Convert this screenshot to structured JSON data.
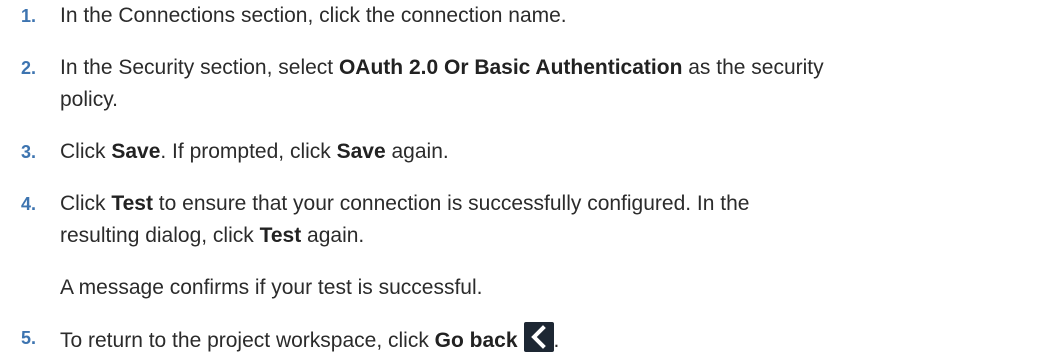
{
  "steps": [
    {
      "number": "1.",
      "parts": [
        "In the Connections section, click the connection name."
      ]
    },
    {
      "number": "2.",
      "parts": [
        "In the Security section, select ",
        "OAuth 2.0 Or Basic Authentication",
        " as the security",
        "policy."
      ]
    },
    {
      "number": "3.",
      "parts": [
        "Click ",
        "Save",
        ". If prompted, click ",
        "Save",
        " again."
      ]
    },
    {
      "number": "4.",
      "parts": [
        "Click ",
        "Test",
        " to ensure that your connection is successfully configured. In the",
        "resulting dialog, click ",
        "Test",
        " again."
      ],
      "note": "A message confirms if your test is successful."
    },
    {
      "number": "5.",
      "parts": [
        "To return to the project workspace, click ",
        "Go back",
        "."
      ],
      "icon": "chevron-left-icon"
    }
  ],
  "colors": {
    "step_number": "#3d74b0",
    "text": "#2b2b2b",
    "icon_bg": "#1d2733"
  }
}
